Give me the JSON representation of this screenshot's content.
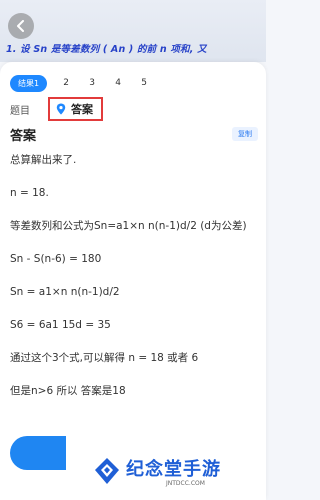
{
  "question": {
    "text": "1. 设 Sn 是等差数列 ( An ) 的前 n 项和, 又"
  },
  "tabs": {
    "active": "结果1",
    "others": [
      "2",
      "3",
      "4",
      "5"
    ]
  },
  "sections": {
    "question_label": "题目",
    "answer_label": "答案"
  },
  "answer": {
    "title": "答案",
    "copy_label": "复制",
    "lines": [
      "总算解出来了.",
      "n = 18.",
      "等差数列和公式为Sn=a1×n n(n-1)d/2 (d为公差)",
      "Sn - S(n-6) = 180",
      "Sn = a1×n n(n-1)d/2",
      "S6 = 6a1 15d = 35",
      "通过这个3个式,可以解得 n = 18 或者 6",
      "但是n>6 所以 答案是18"
    ]
  },
  "watermark": {
    "title": "纪念堂手游",
    "sub": "JNTDCC.COM"
  },
  "colors": {
    "accent": "#1e88ff",
    "highlight_border": "#e23b3b",
    "question_text": "#2742c8"
  }
}
